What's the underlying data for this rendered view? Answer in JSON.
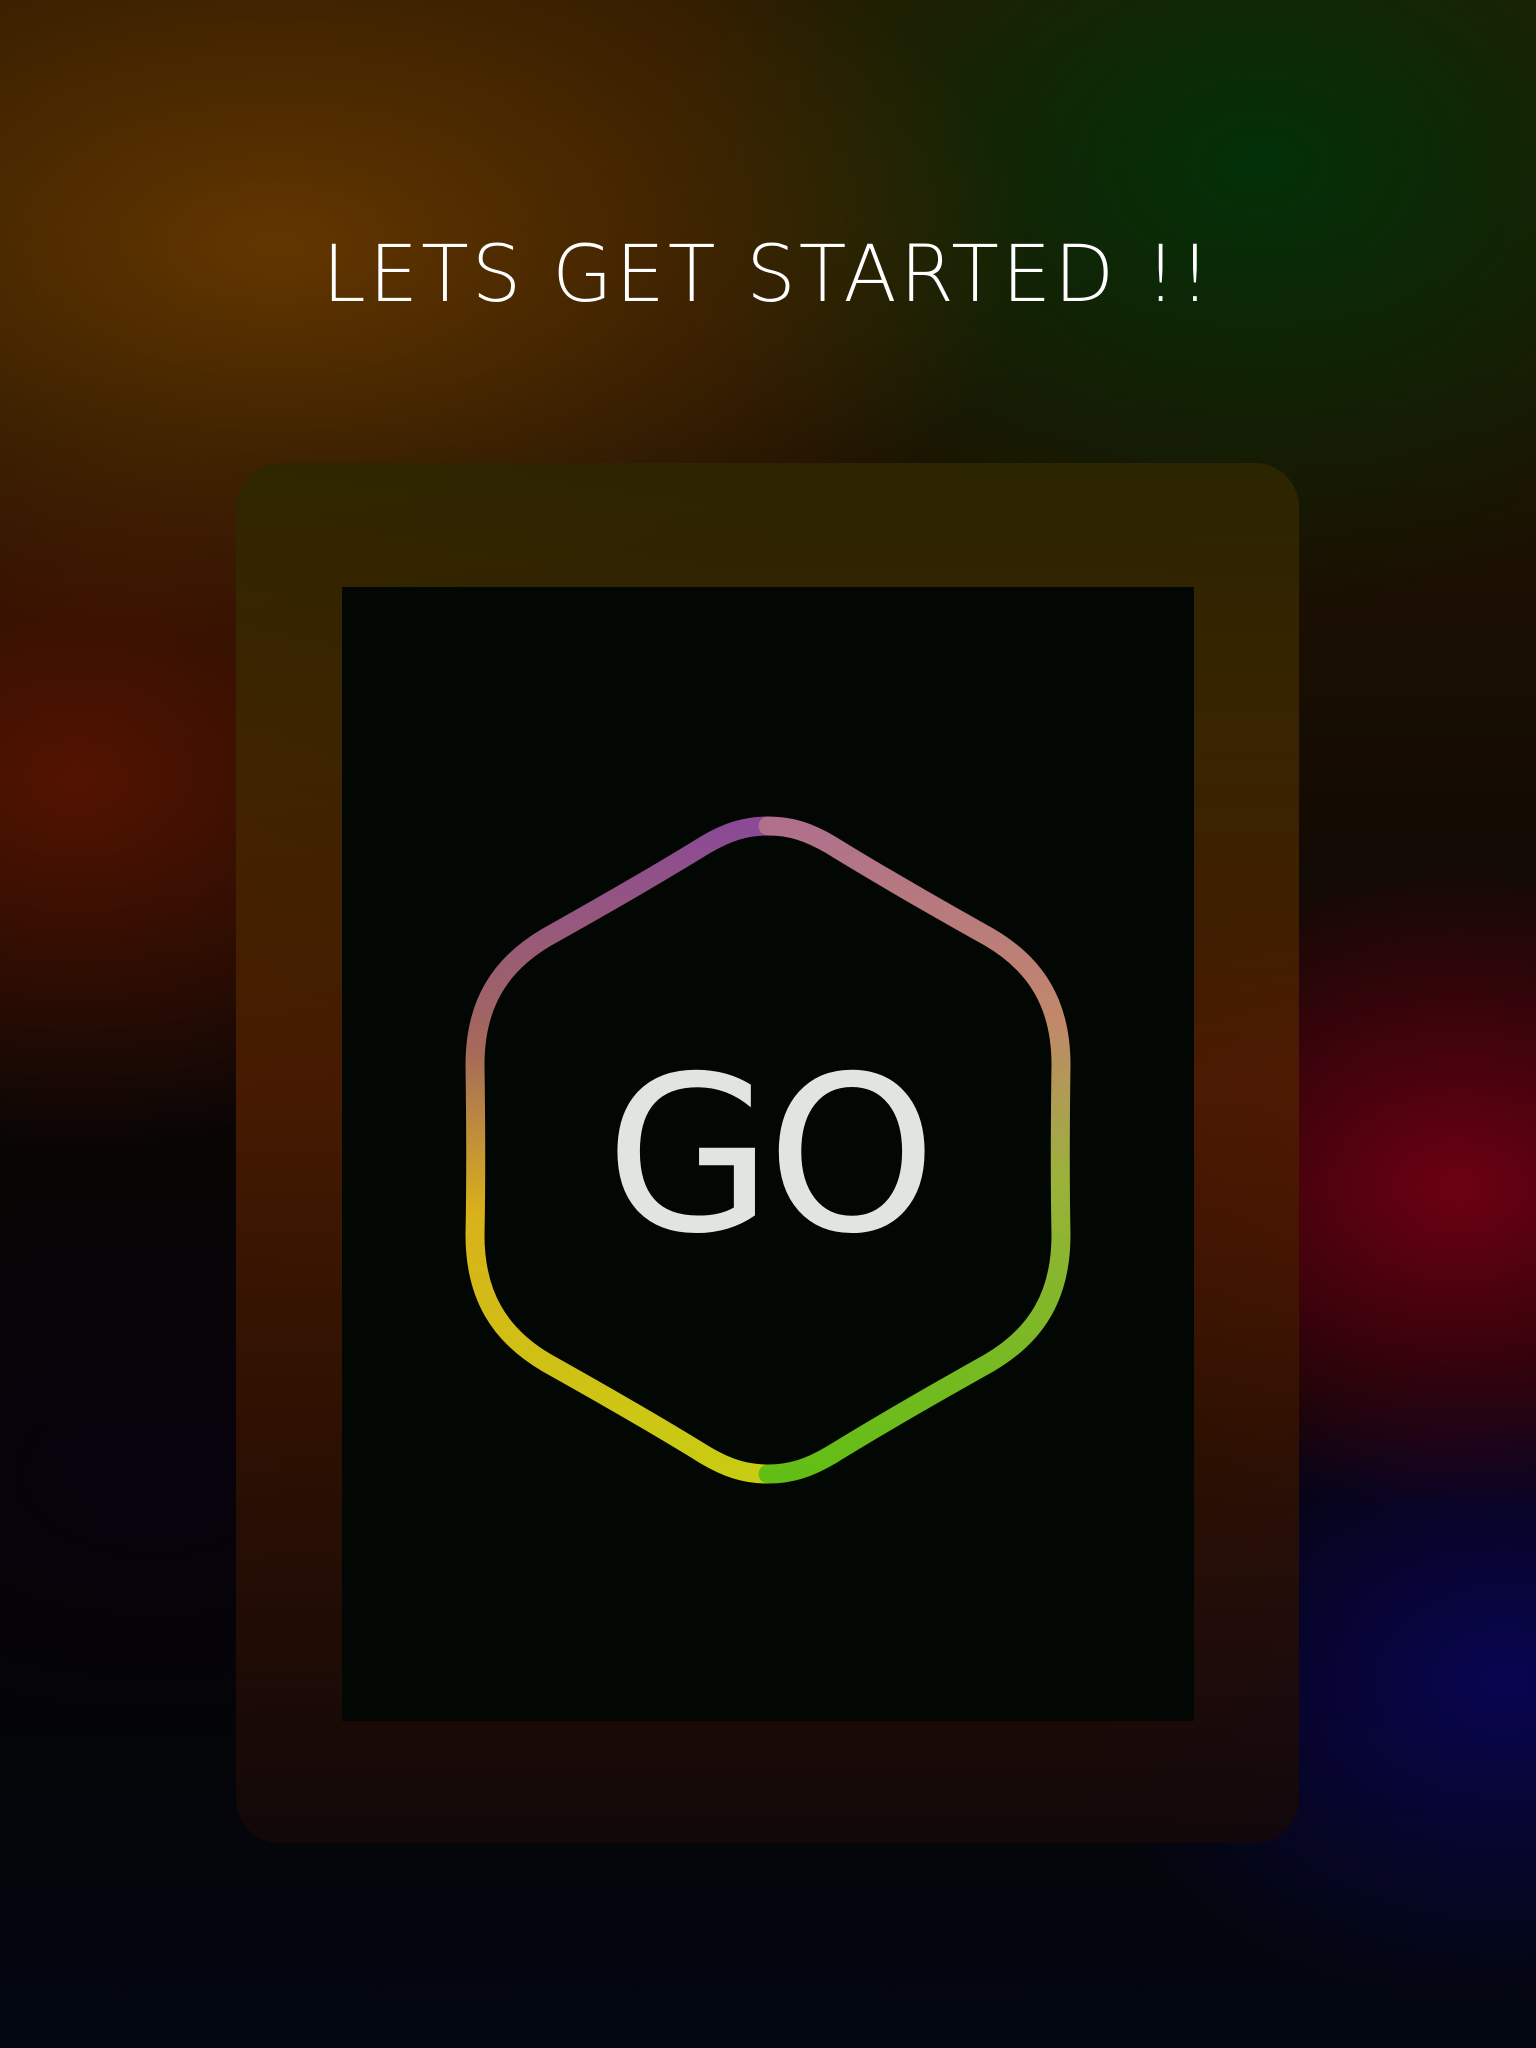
{
  "screen": {
    "headline": "LETS GET STARTED !!",
    "go_button": {
      "label": "GO",
      "icon": "hexagon-icon",
      "gradient_colors": {
        "top": "#8a4a96",
        "top_right": "#c77a80",
        "right": "#6cbf1a",
        "bottom": "#b8c61a",
        "left_bottom": "#e2c812",
        "left": "#a86a3a"
      },
      "text_color": "#e2e4e0"
    }
  },
  "colors": {
    "screen_background": "#020704",
    "headline_color": "#ffffff"
  }
}
